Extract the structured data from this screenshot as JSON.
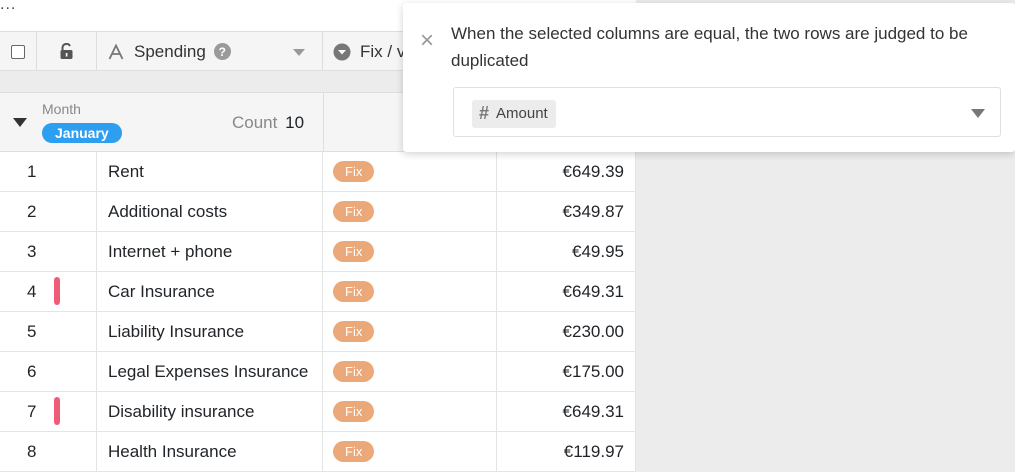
{
  "toolbar": {
    "more_glyph": "..."
  },
  "header": {
    "spending_label": "Spending",
    "help_glyph": "?",
    "fix_label": "Fix / v"
  },
  "group": {
    "field_label": "Month",
    "value": "January",
    "count_label": "Count",
    "count_value": "10"
  },
  "rows": [
    {
      "num": "1",
      "name": "Rent",
      "type": "Fix",
      "amount": "€649.39",
      "marked": false
    },
    {
      "num": "2",
      "name": "Additional costs",
      "type": "Fix",
      "amount": "€349.87",
      "marked": false
    },
    {
      "num": "3",
      "name": "Internet + phone",
      "type": "Fix",
      "amount": "€49.95",
      "marked": false
    },
    {
      "num": "4",
      "name": "Car Insurance",
      "type": "Fix",
      "amount": "€649.31",
      "marked": true
    },
    {
      "num": "5",
      "name": "Liability Insurance",
      "type": "Fix",
      "amount": "€230.00",
      "marked": false
    },
    {
      "num": "6",
      "name": "Legal Expenses Insurance",
      "type": "Fix",
      "amount": "€175.00",
      "marked": false
    },
    {
      "num": "7",
      "name": "Disability insurance",
      "type": "Fix",
      "amount": "€649.31",
      "marked": true
    },
    {
      "num": "8",
      "name": "Health Insurance",
      "type": "Fix",
      "amount": "€119.97",
      "marked": false
    }
  ],
  "panel": {
    "description": "When the selected columns are equal, the two rows are judged to be duplicated",
    "close_glyph": "×",
    "selected_column": "Amount",
    "column_icon_glyph": "#"
  },
  "colors": {
    "fix_tag": "#eba878",
    "duplicate_mark": "#ef5c78",
    "group_badge": "#2d9ef0"
  }
}
